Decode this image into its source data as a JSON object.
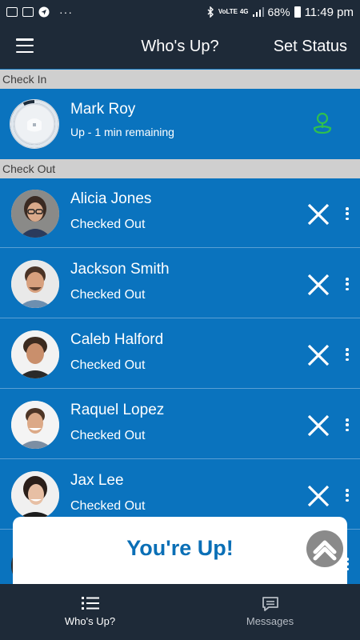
{
  "status_bar": {
    "dots": "···",
    "network_small": "VoLTE",
    "network_4g": "4G",
    "battery": "68%",
    "time": "11:49 pm"
  },
  "app_bar": {
    "title": "Who's Up?",
    "action": "Set Status"
  },
  "check_in": {
    "header": "Check In",
    "user": {
      "name": "Mark Roy",
      "status": "Up - 1 min remaining",
      "progress_fraction": 0.92
    }
  },
  "check_out": {
    "header": "Check Out",
    "users": [
      {
        "name": "Alicia Jones",
        "status": "Checked Out"
      },
      {
        "name": "Jackson Smith",
        "status": "Checked Out"
      },
      {
        "name": "Caleb Halford",
        "status": "Checked Out"
      },
      {
        "name": "Raquel Lopez",
        "status": "Checked Out"
      },
      {
        "name": "Jax Lee",
        "status": "Checked Out"
      }
    ]
  },
  "popup": {
    "text": "You're Up!"
  },
  "bottom_nav": {
    "items": [
      {
        "label": "Who's Up?",
        "icon": "list-icon",
        "active": true
      },
      {
        "label": "Messages",
        "icon": "chat-icon",
        "active": false
      }
    ]
  },
  "colors": {
    "primary_blue": "#0a73be",
    "dark_navy": "#1e2a38",
    "section_gray": "#cfcfcf",
    "accent_green": "#2fbf4f"
  }
}
